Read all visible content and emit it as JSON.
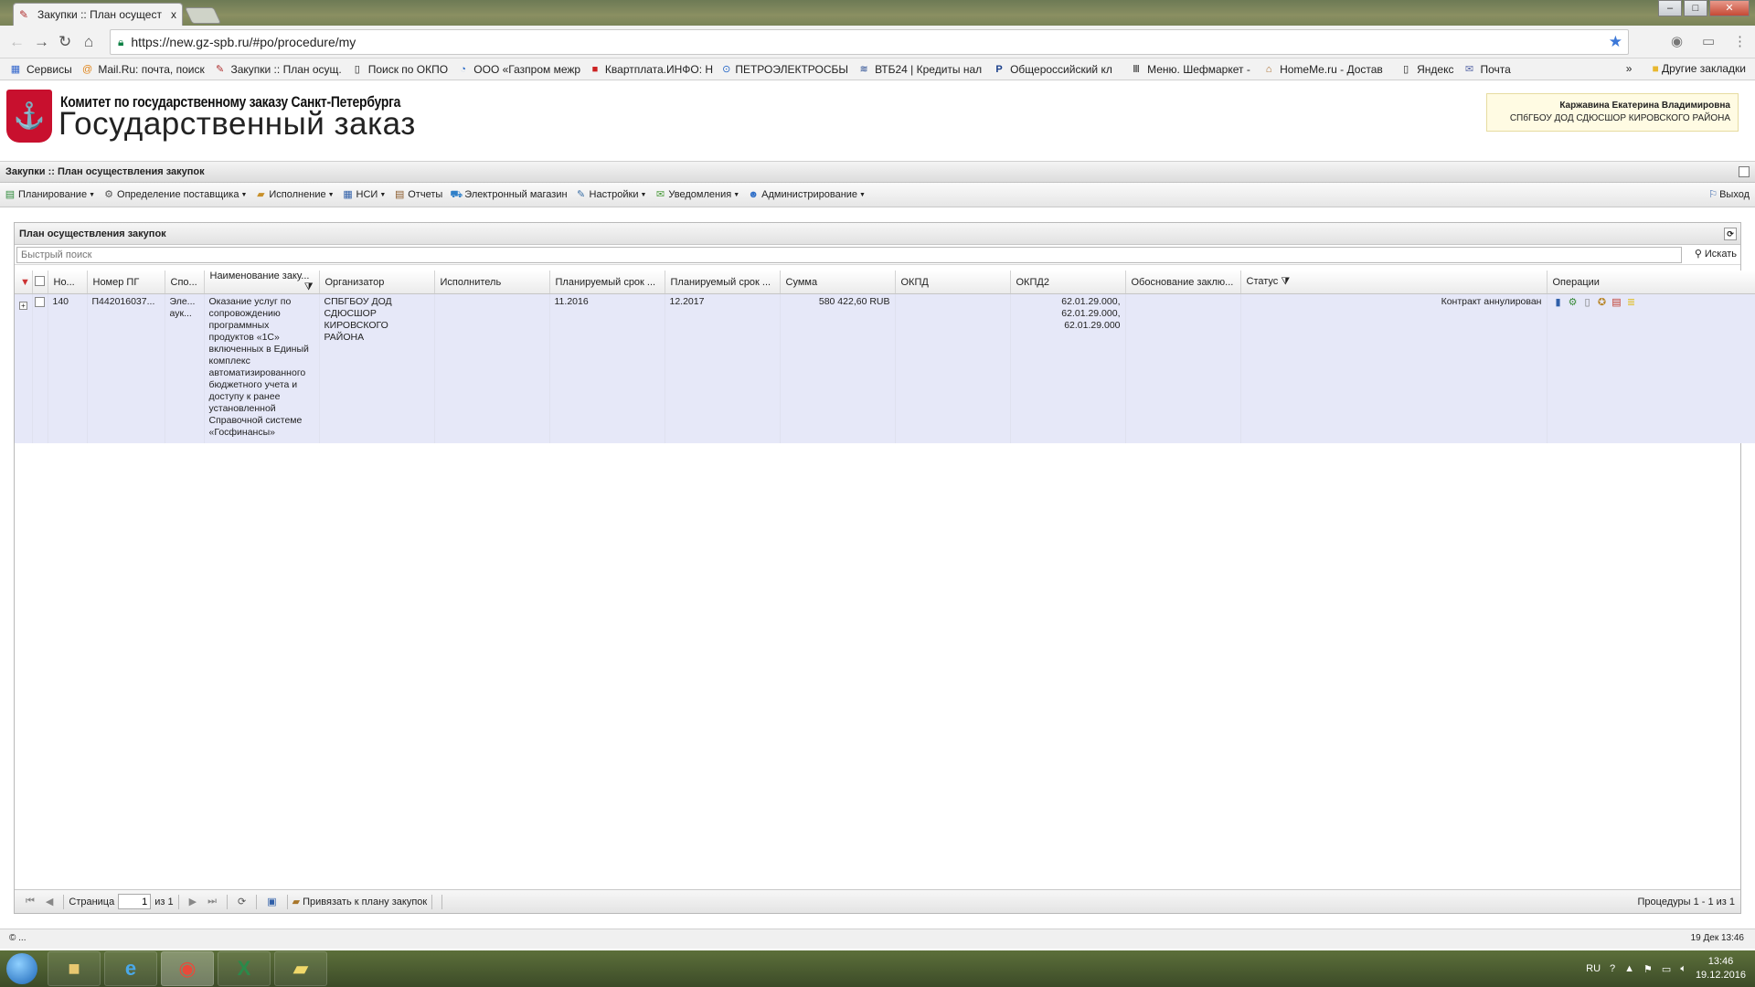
{
  "browser": {
    "tab_title": "Закупки :: План осущест",
    "tab_close": "x",
    "url": "https://new.gz-spb.ru/#po/procedure/my",
    "window_buttons": [
      "–",
      "□",
      "✕"
    ]
  },
  "bookmarks": {
    "items": [
      {
        "label": "Сервисы",
        "icon": "apps-icon"
      },
      {
        "label": "Mail.Ru: почта, поиск",
        "icon": "mailru-icon"
      },
      {
        "label": "Закупки :: План осущ.",
        "icon": "gz-icon"
      },
      {
        "label": "Поиск по ОКПО",
        "icon": "page-icon"
      },
      {
        "label": "ООО «Газпром межр",
        "icon": "gazprom-icon"
      },
      {
        "label": "Квартплата.ИНФО: Н",
        "icon": "kvartplata-icon"
      },
      {
        "label": "ПЕТРОЭЛЕКТРОСБЫТ",
        "icon": "petro-icon"
      },
      {
        "label": "ВТБ24 | Кредиты нал",
        "icon": "vtb-icon"
      },
      {
        "label": "Общероссийский кл",
        "icon": "p3-icon"
      },
      {
        "label": "Меню. Шефмаркет -",
        "icon": "chef-icon"
      },
      {
        "label": "HomeMe.ru - Достав",
        "icon": "homeme-icon"
      },
      {
        "label": "Яндекс",
        "icon": "page-icon"
      },
      {
        "label": "Почта",
        "icon": "mail-icon"
      }
    ],
    "more": "»",
    "other": "Другие закладки"
  },
  "header": {
    "org_small": "Комитет по государственному заказу Санкт-Петербурга",
    "org_big": "Государственный заказ",
    "user_name": "Каржавина Екатерина Владимировна",
    "user_org": "СПбГБОУ ДОД СДЮСШОР КИРОВСКОГО РАЙОНА"
  },
  "page_title": "Закупки :: План осуществления закупок",
  "menu": {
    "items": [
      {
        "label": "Планирование",
        "icon": "planning-icon",
        "glyph": "▤",
        "color": "#2e8b3a",
        "dd": true
      },
      {
        "label": "Определение поставщика",
        "icon": "supplier-icon",
        "glyph": "⚙",
        "color": "#555555",
        "dd": true
      },
      {
        "label": "Исполнение",
        "icon": "execution-icon",
        "glyph": "▰",
        "color": "#c8902a",
        "dd": true
      },
      {
        "label": "НСИ",
        "icon": "nsi-icon",
        "glyph": "▦",
        "color": "#2f5fa8",
        "dd": true
      },
      {
        "label": "Отчеты",
        "icon": "reports-icon",
        "glyph": "▤",
        "color": "#8a5a2a",
        "dd": false
      },
      {
        "label": "Электронный магазин",
        "icon": "eshop-icon",
        "glyph": "⛟",
        "color": "#2f7fc8",
        "dd": false
      },
      {
        "label": "Настройки",
        "icon": "settings-icon",
        "glyph": "✎",
        "color": "#3a6ea5",
        "dd": true
      },
      {
        "label": "Уведомления",
        "icon": "notifications-icon",
        "glyph": "✉",
        "color": "#4a9a3a",
        "dd": true
      },
      {
        "label": "Администрирование",
        "icon": "admin-icon",
        "glyph": "☻",
        "color": "#2f6fc8",
        "dd": true
      }
    ],
    "logout": "Выход",
    "dropdown_glyph": "▼"
  },
  "panel": {
    "title": "План осуществления закупок",
    "search_placeholder": "Быстрый поиск",
    "search_button": "Искать"
  },
  "table": {
    "columns": [
      "Но...",
      "Номер ПГ",
      "Спо...",
      "Наименование заку...",
      "Организатор",
      "Исполнитель",
      "Планируемый срок ...",
      "Планируемый срок ...",
      "Сумма",
      "ОКПД",
      "ОКПД2",
      "Обоснование заклю...",
      "Статус",
      "Операции"
    ],
    "rows": [
      {
        "num": "140",
        "pg_number": "П442016037...",
        "method": "Эле... аук...",
        "name": "Оказание услуг по сопровождению программных продуктов «1С» включенных в Единый комплекс автоматизированного бюджетного учета и доступу к ранее установленной Справочной системе «Госфинансы»",
        "organizer": "СПБГБОУ ДОД СДЮСШОР КИРОВСКОГО РАЙОНА",
        "executor": "",
        "plan_start": "11.2016",
        "plan_end": "12.2017",
        "sum": "580 422,60 RUB",
        "okpd": "",
        "okpd2": "62.01.29.000, 62.01.29.000, 62.01.29.000",
        "justification": "",
        "status": "Контракт аннулирован"
      }
    ]
  },
  "pager": {
    "page_label": "Страница",
    "page_value": "1",
    "of_label": "из 1",
    "attach_label": "Привязать к плану закупок",
    "info": "Процедуры 1 - 1 из 1"
  },
  "statusbar": {
    "left": "© ...",
    "right": "19 Дек 13:46"
  },
  "taskbar": {
    "lang": "RU",
    "time": "13:46",
    "date": "19.12.2016"
  }
}
